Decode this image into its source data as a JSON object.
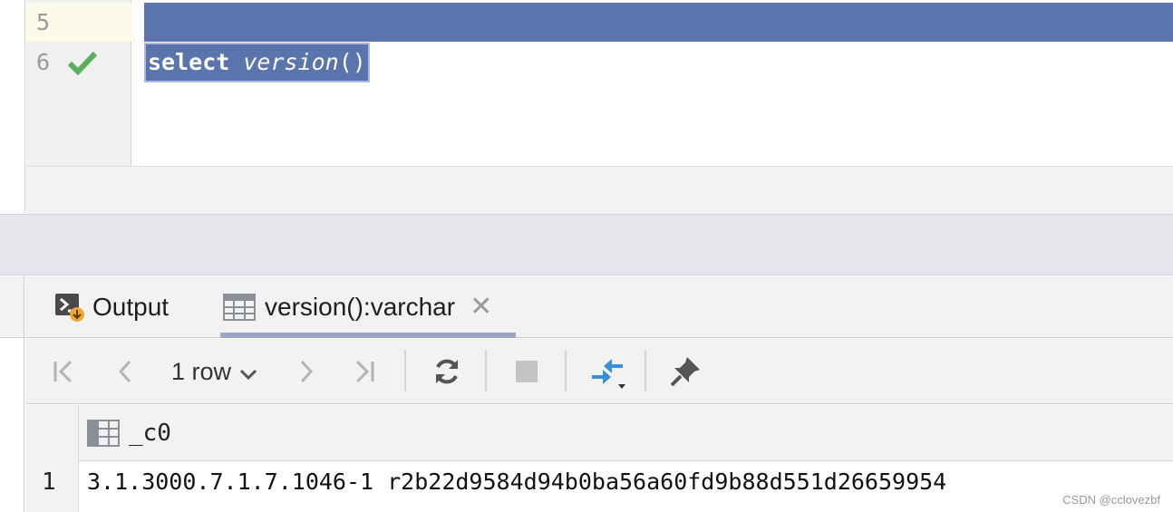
{
  "editor": {
    "line_numbers": [
      "5",
      "6"
    ],
    "code_keyword": "select",
    "code_space": " ",
    "code_function": "version",
    "code_parens": "()"
  },
  "tabs": [
    {
      "label": "Output",
      "icon": "console-output-icon"
    },
    {
      "label": "version():varchar",
      "icon": "table-icon",
      "active": true
    }
  ],
  "toolbar": {
    "row_count_label": "1 row"
  },
  "grid": {
    "columns": [
      "_c0"
    ],
    "rows": [
      {
        "num": "1",
        "cells": [
          "3.1.3000.7.1.7.1046-1 r2b22d9584d94b0ba56a60fd9b88d551d26659954"
        ]
      }
    ]
  },
  "watermark": "CSDN @cclovezbf",
  "colors": {
    "selection": "#5a74ad",
    "check_green": "#5aae5e",
    "accent_blue": "#3b8fd6",
    "tab_underline": "#9aa7c4"
  }
}
